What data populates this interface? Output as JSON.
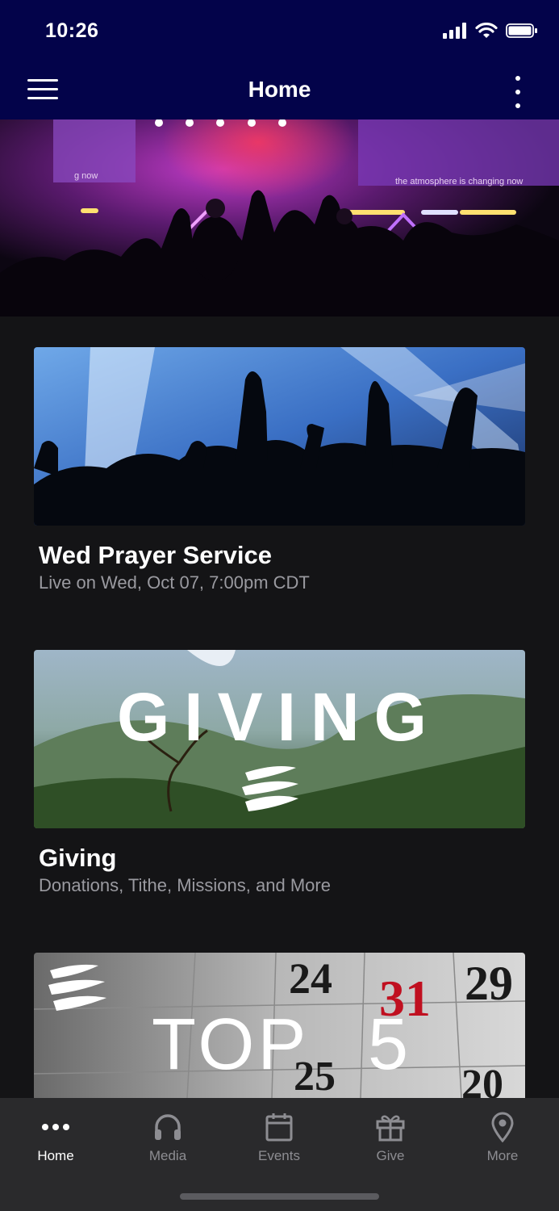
{
  "status": {
    "time": "10:26"
  },
  "header": {
    "title": "Home"
  },
  "hero": {
    "screen_left_text": "g now",
    "screen_right_text": "the atmosphere is changing now"
  },
  "cards": [
    {
      "title": "Wed Prayer Service",
      "subtitle": "Live on Wed, Oct 07, 7:00pm CDT"
    },
    {
      "title": "Giving",
      "subtitle": "Donations, Tithe, Missions, and More",
      "image_text": "GIVING"
    },
    {
      "image_text_left": "TOP",
      "image_text_right": "5",
      "calendar_numbers": [
        "24",
        "31",
        "29",
        "25",
        "20"
      ]
    }
  ],
  "tabs": [
    {
      "label": "Home",
      "icon": "dots-icon",
      "active": true
    },
    {
      "label": "Media",
      "icon": "headphones-icon",
      "active": false
    },
    {
      "label": "Events",
      "icon": "calendar-icon",
      "active": false
    },
    {
      "label": "Give",
      "icon": "gift-icon",
      "active": false
    },
    {
      "label": "More",
      "icon": "location-pin-icon",
      "active": false
    }
  ],
  "colors": {
    "nav_bg": "#03034a",
    "page_bg": "#141416",
    "tabbar_bg": "#2a2a2c"
  }
}
